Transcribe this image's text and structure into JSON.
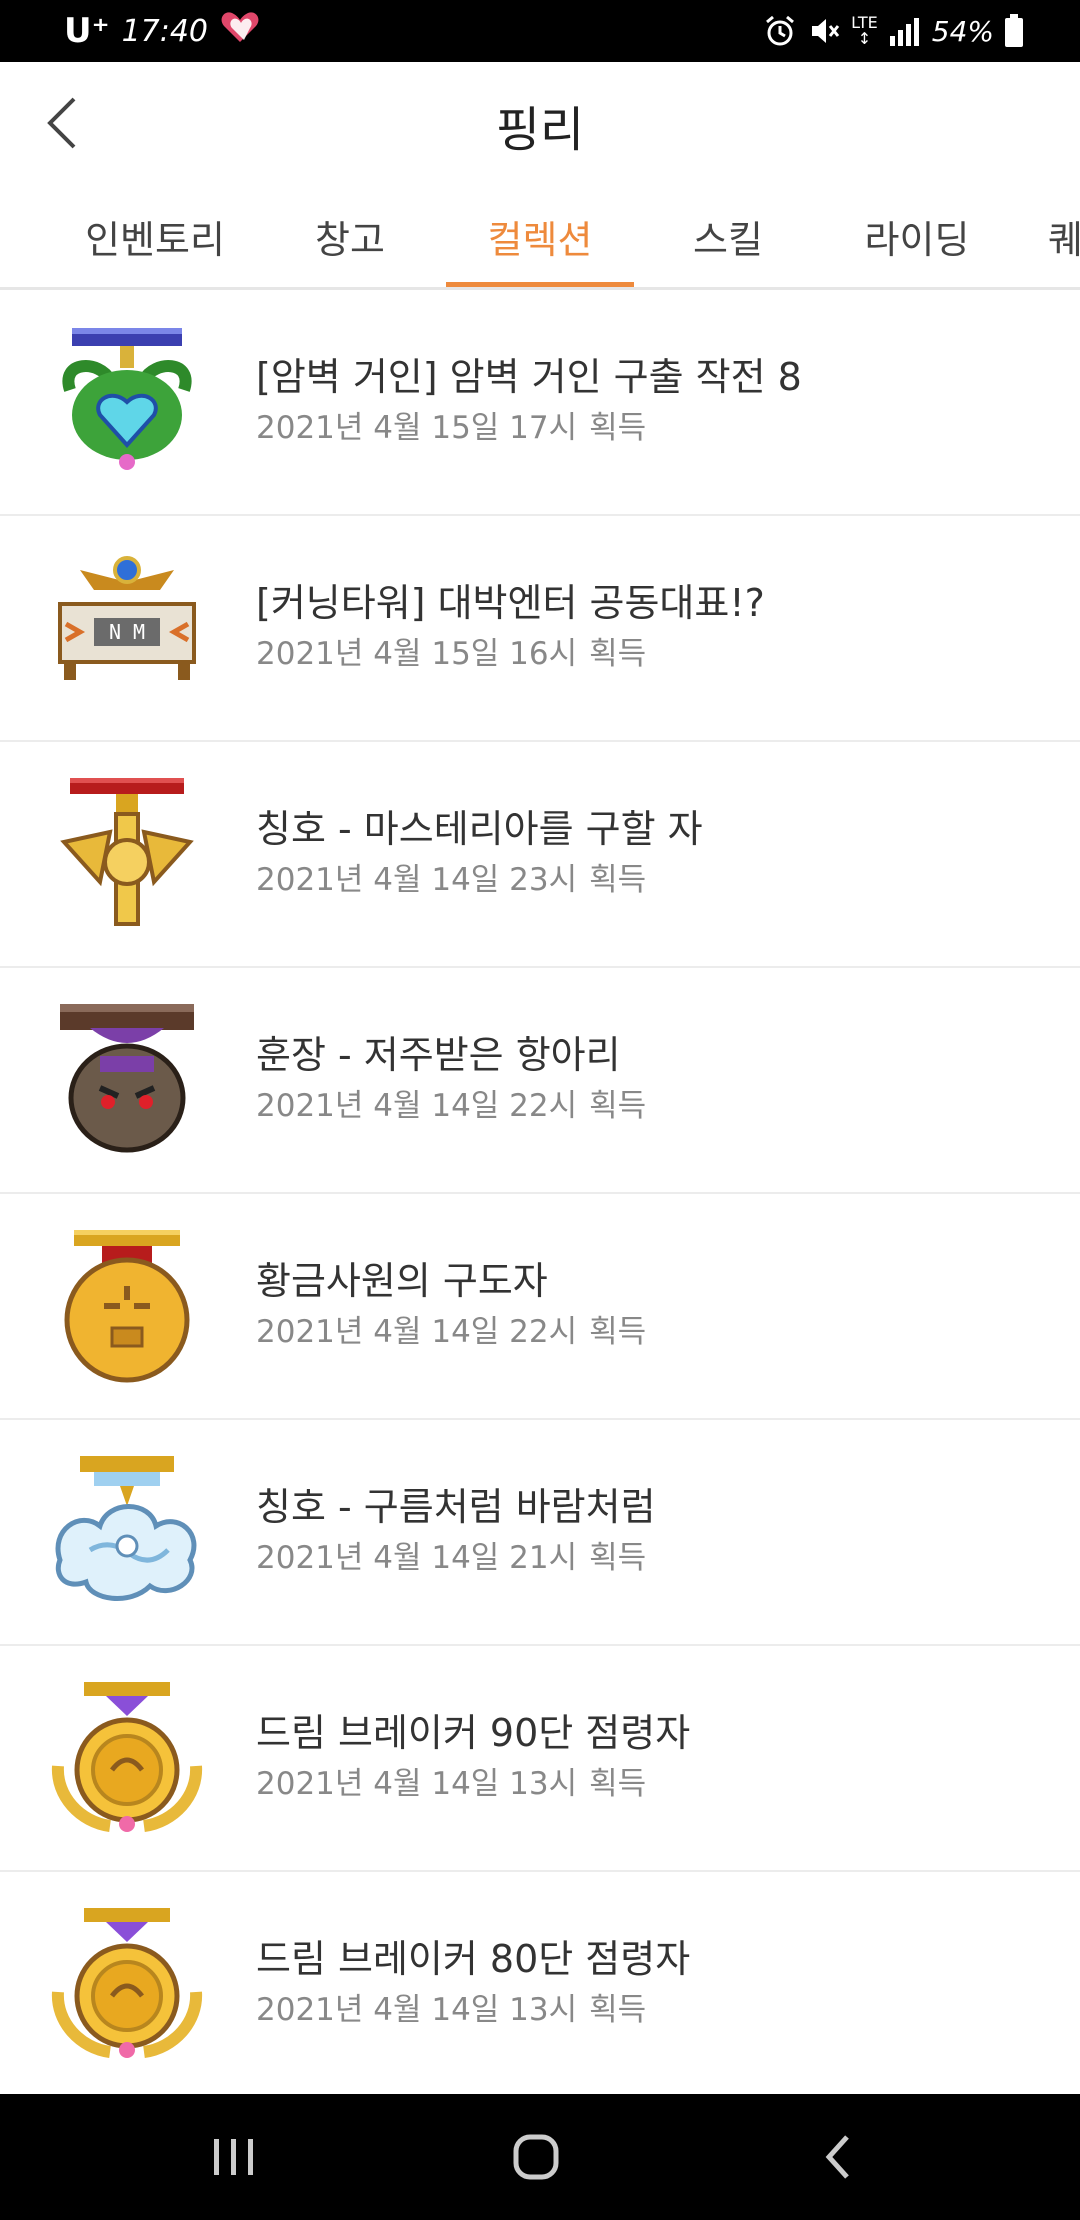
{
  "status_bar": {
    "carrier": "U⁺",
    "time": "17:40",
    "network": "LTE",
    "battery": "54%"
  },
  "header": {
    "title": "핑리"
  },
  "tabs": [
    {
      "label": "인벤토리"
    },
    {
      "label": "창고"
    },
    {
      "label": "컬렉션"
    },
    {
      "label": "스킬"
    },
    {
      "label": "라이딩"
    },
    {
      "label": "퀘"
    }
  ],
  "active_tab": "컬렉션",
  "colors": {
    "accent": "#ee8a3c",
    "text_primary": "#333333",
    "text_secondary": "#888888"
  },
  "items": [
    {
      "name": "[암벽 거인] 암벽 거인 구출 작전 8",
      "date": "2021년 4월 15일 17시",
      "status": "획득",
      "icon": "medal-green-heart-icon"
    },
    {
      "name": "[커닝타워] 대박엔터 공동대표!?",
      "date": "2021년 4월 15일 16시",
      "status": "획득",
      "icon": "nameplate-badge-icon"
    },
    {
      "name": "칭호 - 마스테리아를 구할 자",
      "date": "2021년 4월 14일 23시",
      "status": "획득",
      "icon": "medal-gold-eagle-icon"
    },
    {
      "name": "훈장 - 저주받은 항아리",
      "date": "2021년 4월 14일 22시",
      "status": "획득",
      "icon": "medal-cursed-jar-icon"
    },
    {
      "name": "황금사원의 구도자",
      "date": "2021년 4월 14일 22시",
      "status": "획득",
      "icon": "medal-golden-mask-icon"
    },
    {
      "name": "칭호 - 구름처럼 바람처럼",
      "date": "2021년 4월 14일 21시",
      "status": "획득",
      "icon": "medal-cloud-icon"
    },
    {
      "name": "드림 브레이커 90단 점령자",
      "date": "2021년 4월 14일 13시",
      "status": "획득",
      "icon": "medal-dream-breaker-icon"
    },
    {
      "name": "드림 브레이커 80단 점령자",
      "date": "2021년 4월 14일 13시",
      "status": "획득",
      "icon": "medal-dream-breaker-icon"
    }
  ]
}
